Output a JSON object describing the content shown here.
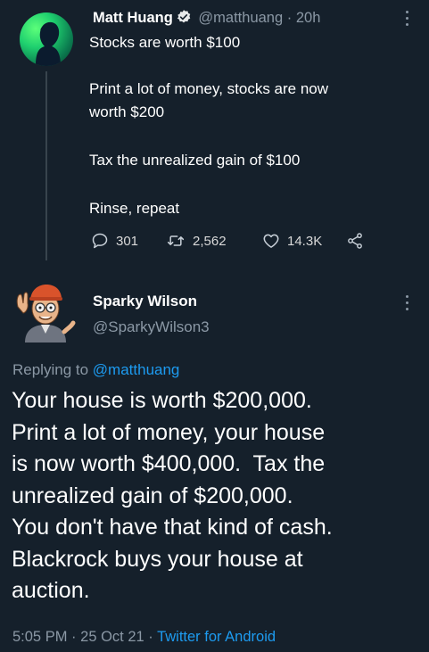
{
  "tweet": {
    "author_name": "Matt Huang",
    "author_handle": "@matthuang",
    "separator": "·",
    "time": "20h",
    "lines": [
      "Stocks are worth $100",
      "Print a lot of money, stocks are now",
      "worth $200",
      "Tax the unrealized gain of $100",
      "Rinse, repeat"
    ],
    "replies": "301",
    "retweets": "2,562",
    "likes": "14.3K",
    "icons": [
      "verified-badge-icon",
      "more-icon",
      "reply-icon",
      "retweet-icon",
      "like-icon",
      "share-icon"
    ]
  },
  "reply": {
    "author_name": "Sparky Wilson",
    "author_handle": "@SparkyWilson3",
    "replying_prefix": "Replying to",
    "replying_to": "@matthuang",
    "body_lines": [
      "Your house is worth $200,000.",
      "Print a lot of money, your house",
      "is now worth $400,000.  Tax the",
      "unrealized gain of $200,000.",
      "You don't have that kind of cash.",
      "Blackrock buys your house at",
      "auction."
    ],
    "time": "5:05 PM",
    "sep1": "·",
    "date": "25 Oct 21",
    "sep2": "·",
    "source": "Twitter for Android"
  },
  "colors": {
    "background": "#15202b",
    "muted": "#8b98a5",
    "link": "#1d9bf0",
    "verified": "#1d9bf0"
  }
}
